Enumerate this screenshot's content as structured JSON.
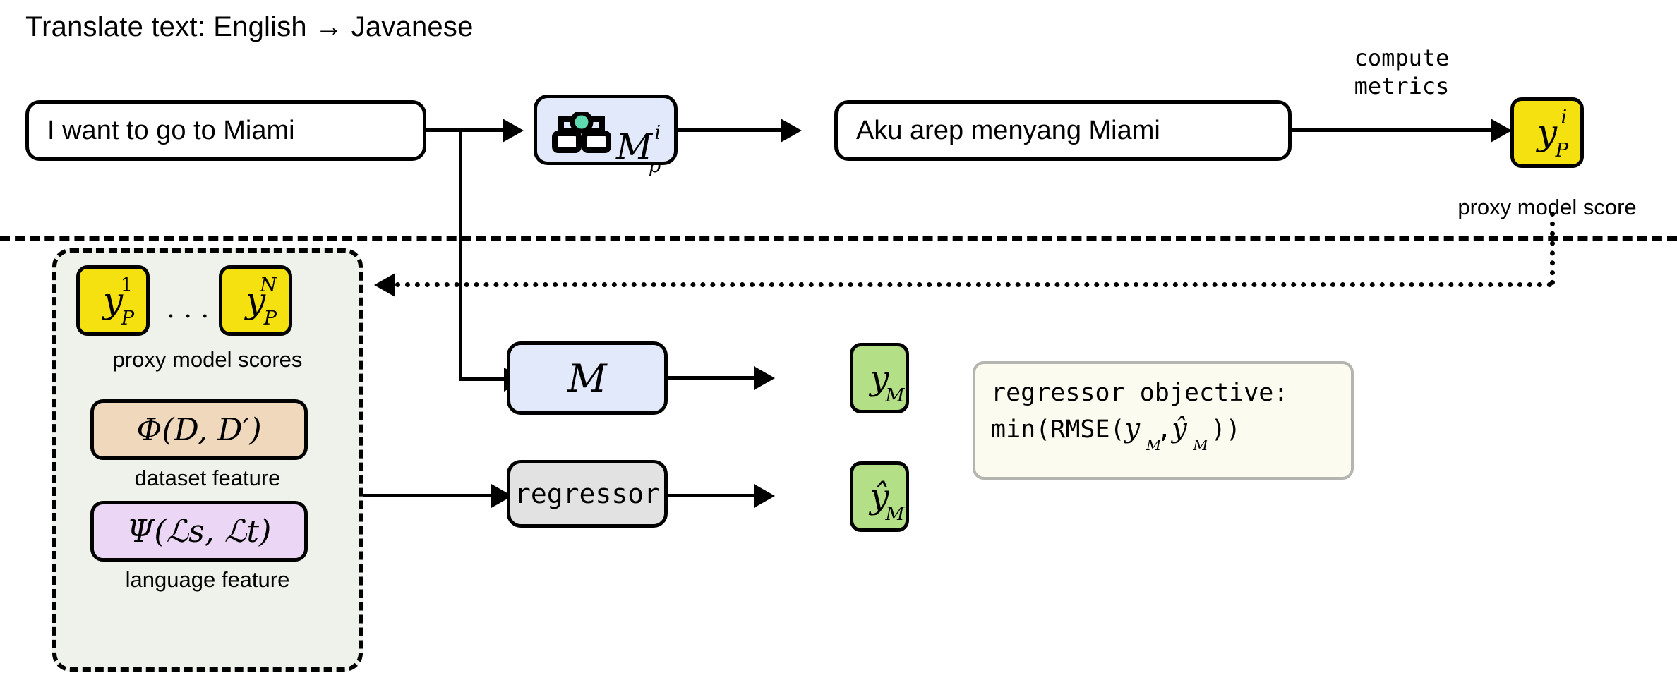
{
  "diagram": {
    "title": "Translate text: English → Javanese",
    "top_pipeline": {
      "source_sentence": "I want to go to Miami",
      "proxy_model": {
        "symbol": "M",
        "superscript": "i",
        "subscript": "p",
        "icon": "model-hierarchy-icon"
      },
      "translated_sentence": "Aku arep menyang Miami",
      "edge_label_line1": "compute",
      "edge_label_line2": "metrics",
      "proxy_score": {
        "symbol": "y",
        "superscript": "i",
        "subscript": "P"
      },
      "proxy_score_caption": "proxy model score"
    },
    "feature_group": {
      "proxy_scores": [
        {
          "symbol": "y",
          "superscript": "1",
          "subscript": "P"
        },
        {
          "symbol": "y",
          "superscript": "N",
          "subscript": "P"
        }
      ],
      "ellipsis": ". . .",
      "proxy_scores_caption": "proxy model scores",
      "dataset_feature": {
        "formula": "Φ(D,  D′)",
        "caption": "dataset feature"
      },
      "language_feature": {
        "formula": "Ψ(ℒs,  ℒt)",
        "caption": "language feature"
      }
    },
    "bottom_pipeline": {
      "target_model": {
        "symbol": "M"
      },
      "target_model_output": {
        "symbol": "y",
        "subscript": "M"
      },
      "regressor": {
        "label": "regressor"
      },
      "regressor_output": {
        "symbol": "ŷ",
        "subscript": "M"
      }
    },
    "objective_box": {
      "line1": "regressor objective:",
      "line2_prefix": "min(RMSE(",
      "line2_y": "y",
      "line2_sub1": "M",
      "line2_comma": ",",
      "line2_yhat": "ŷ",
      "line2_sub2": "M",
      "line2_suffix": "))"
    },
    "colors": {
      "proxy_score_yellow": "#f5e010",
      "model_blue": "#e2e9fa",
      "output_green": "#b3e086",
      "dataset_feature_tan": "#f0d8bd",
      "language_feature_purple": "#ecd6f5",
      "regressor_gray": "#e2e2e2",
      "objective_cream": "#fbfbef",
      "group_bg": "#eef2ea",
      "icon_dot_green": "#5ed9b0"
    }
  }
}
